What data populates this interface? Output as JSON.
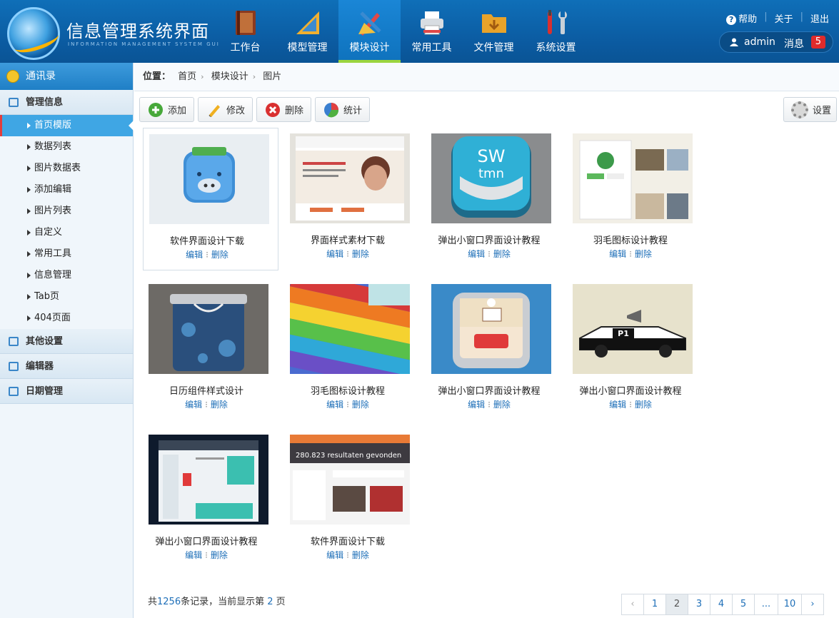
{
  "header": {
    "brand_title": "信息管理系统界面",
    "brand_subtitle": "INFORMATION MANAGEMENT SYSTEM GUI",
    "nav": [
      {
        "label": "工作台",
        "icon": "book-icon",
        "color": "#8a3a20"
      },
      {
        "label": "模型管理",
        "icon": "ruler-icon",
        "color": "#3a8ad0"
      },
      {
        "label": "模块设计",
        "icon": "design-tools-icon",
        "color": "#e04848",
        "active": true
      },
      {
        "label": "常用工具",
        "icon": "printer-icon",
        "color": "#d8dde2"
      },
      {
        "label": "文件管理",
        "icon": "folder-icon",
        "color": "#e8a32a"
      },
      {
        "label": "系统设置",
        "icon": "wrench-icon",
        "color": "#c8d0d8"
      }
    ],
    "links": {
      "help": "帮助",
      "about": "关于",
      "logout": "退出"
    },
    "user": {
      "name": "admin",
      "message_label": "消息",
      "message_count": "5"
    }
  },
  "sidebar": {
    "head": "通讯录",
    "groups": [
      {
        "label": "管理信息",
        "items": [
          "首页模版",
          "数据列表",
          "图片数据表",
          "添加编辑",
          "图片列表",
          "自定义",
          "常用工具",
          "信息管理",
          "Tab页",
          "404页面"
        ]
      },
      {
        "label": "其他设置"
      },
      {
        "label": "编辑器"
      },
      {
        "label": "日期管理"
      }
    ]
  },
  "breadcrumb": {
    "prefix": "位置：",
    "items": [
      "首页",
      "模块设计",
      "图片"
    ]
  },
  "toolbar": {
    "add": "添加",
    "edit": "修改",
    "delete": "删除",
    "stats": "统计",
    "settings": "设置"
  },
  "cards": [
    {
      "title": "软件界面设计下载",
      "edit": "编辑",
      "delete": "删除"
    },
    {
      "title": "界面样式素材下载",
      "edit": "编辑",
      "delete": "删除"
    },
    {
      "title": "弹出小窗口界面设计教程",
      "edit": "编辑",
      "delete": "删除"
    },
    {
      "title": "羽毛图标设计教程",
      "edit": "编辑",
      "delete": "删除"
    },
    {
      "title": "日历组件样式设计",
      "edit": "编辑",
      "delete": "删除"
    },
    {
      "title": "羽毛图标设计教程",
      "edit": "编辑",
      "delete": "删除"
    },
    {
      "title": "弹出小窗口界面设计教程",
      "edit": "编辑",
      "delete": "删除"
    },
    {
      "title": "弹出小窗口界面设计教程",
      "edit": "编辑",
      "delete": "删除"
    },
    {
      "title": "弹出小窗口界面设计教程",
      "edit": "编辑",
      "delete": "删除"
    },
    {
      "title": "软件界面设计下载",
      "edit": "编辑",
      "delete": "删除"
    }
  ],
  "thumb_texts": {
    "swtmn": "SW\ntmn",
    "p1": "P1",
    "results": "280.823 resultaten gevonden"
  },
  "footer": {
    "prefix": "共",
    "total": "1256",
    "mid": "条记录，当前显示第 ",
    "page": "2",
    "suffix": " 页"
  },
  "pager": {
    "prev": "‹",
    "pages": [
      "1",
      "2",
      "3",
      "4",
      "5",
      "...",
      "10"
    ],
    "current": "2",
    "next": "›"
  }
}
